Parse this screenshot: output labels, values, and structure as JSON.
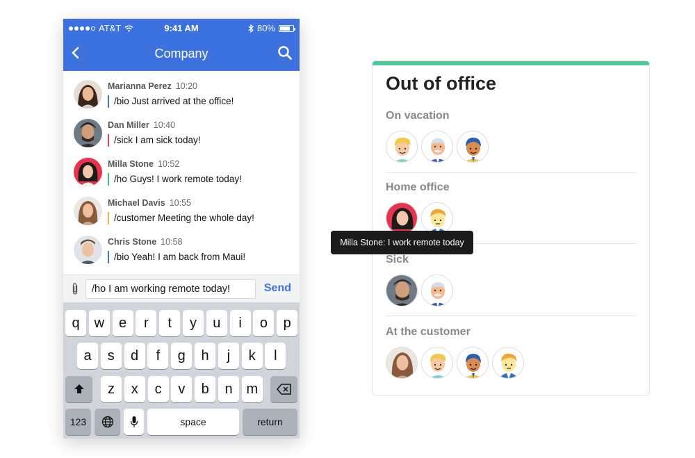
{
  "status_bar": {
    "carrier": "AT&T",
    "time": "9:41 AM",
    "battery": "80%",
    "battery_level": 0.8
  },
  "chat": {
    "title": "Company",
    "messages": [
      {
        "name": "Marianna Perez",
        "time": "10:20",
        "text": "/bio Just arrived at the office!",
        "tag_color": "#3d72de"
      },
      {
        "name": "Dan Miller",
        "time": "10:40",
        "text": "/sick I am sick today!",
        "tag_color": "#e04550"
      },
      {
        "name": "Milla Stone",
        "time": "10:52",
        "text": "/ho Guys! I work remote today!",
        "tag_color": "#3ec07a"
      },
      {
        "name": "Michael Davis",
        "time": "10:55",
        "text": "/customer Meeting the whole day!",
        "tag_color": "#f2b435"
      },
      {
        "name": "Chris Stone",
        "time": "10:58",
        "text": "/bio Yeah! I am back from Maui!",
        "tag_color": "#3d72de"
      }
    ],
    "input_value": "/ho I am working remote today!",
    "send_label": "Send"
  },
  "keyboard": {
    "row1": [
      "q",
      "w",
      "e",
      "r",
      "t",
      "y",
      "u",
      "i",
      "o",
      "p"
    ],
    "row2": [
      "a",
      "s",
      "d",
      "f",
      "g",
      "h",
      "j",
      "k",
      "l"
    ],
    "row3": [
      "z",
      "x",
      "c",
      "v",
      "b",
      "n",
      "m"
    ],
    "numbers_label": "123",
    "space_label": "space",
    "return_label": "return"
  },
  "out_of_office": {
    "title": "Out of office",
    "accent_color": "#4dc99a",
    "sections": [
      {
        "title": "On vacation",
        "members": [
          "cartoon-blonde",
          "cartoon-elder",
          "cartoon-dark"
        ]
      },
      {
        "title": "Home office",
        "members": [
          "photo-milla",
          "cartoon-yellow"
        ]
      },
      {
        "title": "Sick",
        "members": [
          "photo-dan",
          "cartoon-elder"
        ]
      },
      {
        "title": "At the customer",
        "members": [
          "photo-michael",
          "cartoon-blonde",
          "cartoon-dark",
          "cartoon-yellow"
        ]
      }
    ],
    "tooltip": "Milla Stone: I work remote today"
  }
}
